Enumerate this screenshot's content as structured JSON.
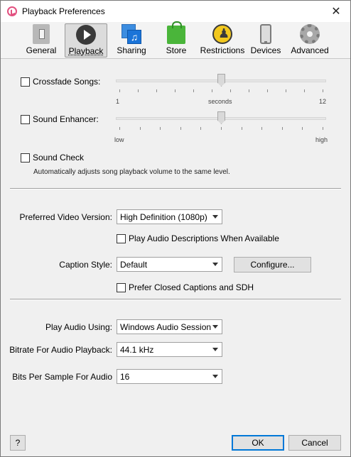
{
  "window": {
    "title": "Playback Preferences"
  },
  "toolbar": {
    "items": [
      {
        "label": "General"
      },
      {
        "label": "Playback"
      },
      {
        "label": "Sharing",
        "glyph": "♫"
      },
      {
        "label": "Store"
      },
      {
        "label": "Restrictions"
      },
      {
        "label": "Devices"
      },
      {
        "label": "Advanced"
      }
    ],
    "selected": "Playback"
  },
  "crossfade": {
    "label": "Crossfade Songs:",
    "checked": false,
    "min_label": "1",
    "mid_label": "seconds",
    "max_label": "12",
    "value_fraction": 0.5
  },
  "enhancer": {
    "label": "Sound Enhancer:",
    "checked": false,
    "min_label": "low",
    "max_label": "high",
    "value_fraction": 0.5
  },
  "soundcheck": {
    "label": "Sound Check",
    "checked": false,
    "description": "Automatically adjusts song playback volume to the same level."
  },
  "video": {
    "label": "Preferred Video Version:",
    "value": "High Definition (1080p)",
    "audio_desc_label": "Play Audio Descriptions When Available",
    "audio_desc_checked": false
  },
  "caption": {
    "label": "Caption Style:",
    "value": "Default",
    "configure_label": "Configure...",
    "closed_captions_label": "Prefer Closed Captions and SDH",
    "closed_captions_checked": false
  },
  "audio": {
    "play_using_label": "Play Audio Using:",
    "play_using_value": "Windows Audio Session",
    "bitrate_label": "Bitrate For Audio Playback:",
    "bitrate_value": "44.1 kHz",
    "bits_label": "Bits Per Sample For Audio",
    "bits_value": "16"
  },
  "footer": {
    "help_label": "?",
    "ok_label": "OK",
    "cancel_label": "Cancel"
  },
  "icons": {
    "close": "✕"
  }
}
